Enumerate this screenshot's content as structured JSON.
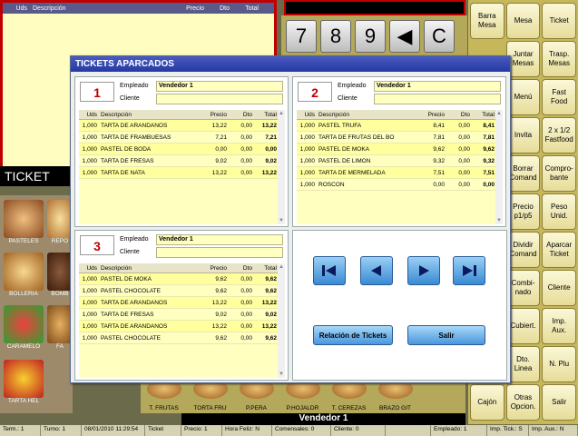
{
  "background_ticket": {
    "columns": [
      "Uds",
      "Descripción",
      "Precio",
      "Dto",
      "Total"
    ],
    "ticket_label": "TICKET"
  },
  "numpad": {
    "keys": [
      "7",
      "8",
      "9",
      "◀",
      "C"
    ]
  },
  "right_buttons": [
    "Barra\nMesa",
    "Mesa",
    "Ticket",
    "",
    "Juntar\nMesas",
    "Trasp.\nMesas",
    "",
    "Menú",
    "Fast\nFood",
    "",
    "Invita",
    "2 x 1/2\nFastfood",
    "",
    "Borrar\nComand",
    "Compro-\nbante",
    "",
    "Precio\np1/p5",
    "Peso\nUnid.",
    "",
    "Dividir\nComand",
    "Aparcar\nTicket",
    "",
    "Combi-\nnado",
    "Cliente",
    "",
    "Cubiert.",
    "Imp.\nAux.",
    "",
    "Dto.\nLinea",
    "N. Plu",
    "Cajón",
    "Otras\nOpcion.",
    "Salir"
  ],
  "categories": [
    {
      "label": "PASTELES"
    },
    {
      "label": "REPO"
    },
    {
      "label": "BOLLERIA"
    },
    {
      "label": "BOMB"
    },
    {
      "label": "CARAMELO"
    },
    {
      "label": "FA"
    },
    {
      "label": "TARTA HEL"
    }
  ],
  "products": [
    "T. FRUTAS",
    "TORTA FRU",
    "P.PERA",
    "P.HOJALDR",
    "T. CEREZAS",
    "BRAZO GIT",
    ""
  ],
  "vendor_bar": "Vendedor 1",
  "status_bar": [
    "Term.: 1",
    "Turno: 1",
    "08/01/2010 11:29:54",
    "Ticket",
    "Precio: 1",
    "Hora Feliz: N",
    "Comensales: 0",
    "Cliente: 0",
    "",
    "Empleado: 1",
    "Imp. Tick.: S",
    "Imp. Aux.: N"
  ],
  "dialog": {
    "title": "TICKETS APARCADOS",
    "field_labels": {
      "employee": "Empleado",
      "client": "Cliente"
    },
    "columns": {
      "uds": "Uds",
      "desc": "Descripción",
      "price": "Precio",
      "dto": "Dto",
      "total": "Total"
    },
    "tickets": [
      {
        "number": "1",
        "employee": "Vendedor 1",
        "client": "",
        "lines": [
          {
            "uds": "1,000",
            "desc": "TARTA DE ARANDANOS",
            "price": "13,22",
            "dto": "0,00",
            "total": "13,22"
          },
          {
            "uds": "1,000",
            "desc": "TARTA DE FRAMBUESAS",
            "price": "7,21",
            "dto": "0,00",
            "total": "7,21"
          },
          {
            "uds": "1,000",
            "desc": "PASTEL DE BODA",
            "price": "0,00",
            "dto": "0,00",
            "total": "0,00"
          },
          {
            "uds": "1,000",
            "desc": "TARTA DE FRESAS",
            "price": "9,02",
            "dto": "0,00",
            "total": "9,02"
          },
          {
            "uds": "1,000",
            "desc": "TARTA DE NATA",
            "price": "13,22",
            "dto": "0,00",
            "total": "13,22"
          }
        ]
      },
      {
        "number": "2",
        "employee": "Vendedor 1",
        "client": "",
        "lines": [
          {
            "uds": "1,000",
            "desc": "PASTEL TRUFA",
            "price": "8,41",
            "dto": "0,00",
            "total": "8,41"
          },
          {
            "uds": "1,000",
            "desc": "TARTA DE FRUTAS DEL BO",
            "price": "7,81",
            "dto": "0,00",
            "total": "7,81"
          },
          {
            "uds": "1,000",
            "desc": "PASTEL DE MOKA",
            "price": "9,62",
            "dto": "0,00",
            "total": "9,62"
          },
          {
            "uds": "1,000",
            "desc": "PASTEL DE LIMON",
            "price": "9,32",
            "dto": "0,00",
            "total": "9,32"
          },
          {
            "uds": "1,000",
            "desc": "TARTA DE MERMELADA",
            "price": "7,51",
            "dto": "0,00",
            "total": "7,51"
          },
          {
            "uds": "1,000",
            "desc": "ROSCON",
            "price": "0,00",
            "dto": "0,00",
            "total": "0,00"
          }
        ]
      },
      {
        "number": "3",
        "employee": "Vendedor 1",
        "client": "",
        "lines": [
          {
            "uds": "1,000",
            "desc": "PASTEL DE MOKA",
            "price": "9,62",
            "dto": "0,00",
            "total": "9,62"
          },
          {
            "uds": "1,000",
            "desc": "PASTEL CHOCOLATE",
            "price": "9,62",
            "dto": "0,00",
            "total": "9,62"
          },
          {
            "uds": "1,000",
            "desc": "TARTA DE ARANDANOS",
            "price": "13,22",
            "dto": "0,00",
            "total": "13,22"
          },
          {
            "uds": "1,000",
            "desc": "TARTA DE FRESAS",
            "price": "9,02",
            "dto": "0,00",
            "total": "9,02"
          },
          {
            "uds": "1,000",
            "desc": "TARTA DE ARANDANOS",
            "price": "13,22",
            "dto": "0,00",
            "total": "13,22"
          },
          {
            "uds": "1,000",
            "desc": "PASTEL CHOCOLATE",
            "price": "9,62",
            "dto": "0,00",
            "total": "9,62"
          }
        ]
      }
    ],
    "nav": {
      "relation_label": "Relación de Tickets",
      "exit_label": "Salir"
    }
  },
  "colors": {
    "title_bar": "#2438a4",
    "ticket_number": "#c00000",
    "row_bg": "#ffffc0",
    "nav_button": "#3a8ad4"
  }
}
